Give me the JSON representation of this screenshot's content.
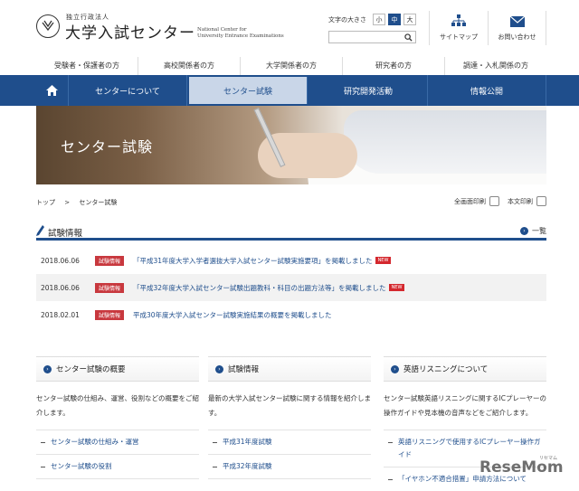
{
  "header": {
    "logo_small": "独立行政法人",
    "logo_main": "大学入試センター",
    "logo_en_line1": "National Center for",
    "logo_en_line2": "University Entrance Examinations",
    "fontsize_label": "文字の大きさ",
    "fontsize_options": [
      "小",
      "中",
      "大"
    ],
    "links": [
      {
        "label": "サイトマップ",
        "icon": "sitemap-icon"
      },
      {
        "label": "お問い合わせ",
        "icon": "mail-icon"
      }
    ]
  },
  "audience_nav": [
    "受験者・保護者の方",
    "高校関係者の方",
    "大学関係者の方",
    "研究者の方",
    "調達・入札関係の方"
  ],
  "main_nav": {
    "items": [
      "センターについて",
      "センター試験",
      "研究開発活動",
      "情報公開"
    ],
    "active": "センター試験"
  },
  "hero": {
    "title": "センター試験"
  },
  "breadcrumb": {
    "home": "トップ",
    "sep": ">",
    "current": "センター試験"
  },
  "print": {
    "full": "全画面印刷",
    "body": "本文印刷"
  },
  "info": {
    "title": "試験情報",
    "more": "一覧",
    "items": [
      {
        "date": "2018.06.06",
        "tag": "試験情報",
        "text": "「平成31年度大学入学者選抜大学入試センター試験実施要項」を掲載しました",
        "new": "NEW"
      },
      {
        "date": "2018.06.06",
        "tag": "試験情報",
        "text": "「平成32年度大学入試センター試験出題教科・科目の出題方法等」を掲載しました",
        "new": "NEW"
      },
      {
        "date": "2018.02.01",
        "tag": "試験情報",
        "text": "平成30年度大学入試センター試験実施結果の概要を掲載しました",
        "new": ""
      }
    ]
  },
  "cards": [
    {
      "title": "センター試験の概要",
      "desc": "センター試験の仕組み、運営、役割などの概要をご紹介します。",
      "links": [
        "センター試験の仕組み・運営",
        "センター試験の役割"
      ]
    },
    {
      "title": "試験情報",
      "desc": "最新の大学入試センター試験に関する情報を紹介します。",
      "links": [
        "平成31年度試験",
        "平成32年度試験"
      ]
    },
    {
      "title": "英語リスニングについて",
      "desc": "センター試験英語リスニングに関するICプレーヤーの操作ガイドや見本機の音声などをご紹介します。",
      "links": [
        "英語リスニングで使用するICプレーヤー操作ガイド",
        "「イヤホン不適合措置」申請方法について"
      ]
    }
  ],
  "watermark": {
    "text": "ReseMom",
    "small": "リセマム"
  },
  "colors": {
    "primary": "#1f4e8c",
    "tag": "#c8383e"
  }
}
